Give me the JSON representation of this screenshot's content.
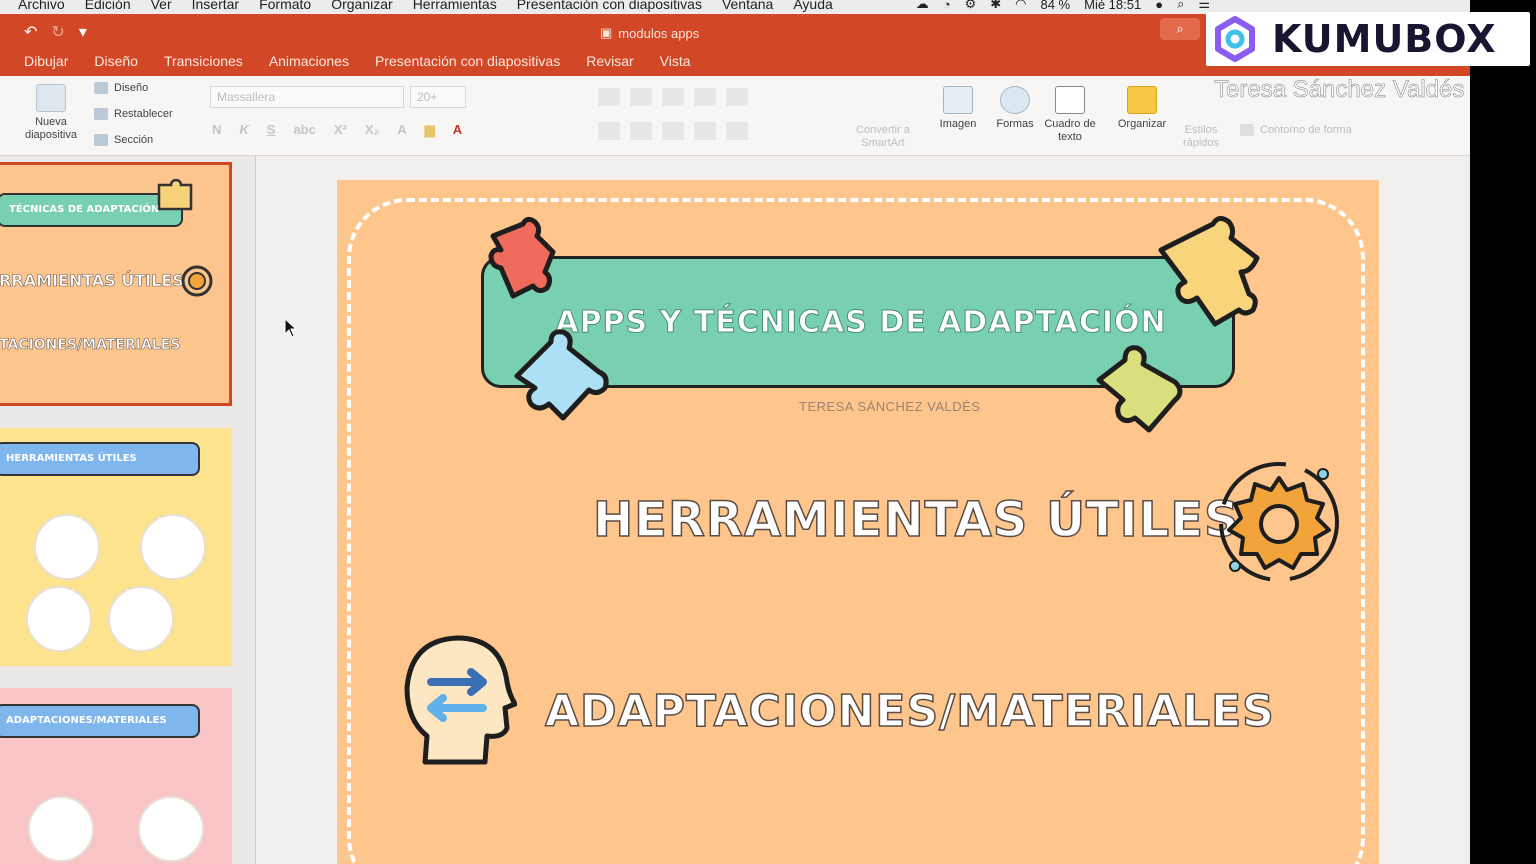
{
  "menubar": {
    "items": [
      "Archivo",
      "Edición",
      "Ver",
      "Insertar",
      "Formato",
      "Organizar",
      "Herramientas",
      "Presentación con diapositivas",
      "Ventana",
      "Ayuda"
    ],
    "battery": "84 %",
    "clock": "Mié 18:51"
  },
  "titlebar": {
    "document": "modulos apps"
  },
  "tabs": [
    "Dibujar",
    "Diseño",
    "Transiciones",
    "Animaciones",
    "Presentación con diapositivas",
    "Revisar",
    "Vista"
  ],
  "ribbon": {
    "new_slide": "Nueva diapositiva",
    "layout": "Diseño",
    "reset": "Restablecer",
    "section": "Sección",
    "font": "Massallera",
    "size": "20+",
    "convert_smartart": "Convertir a SmartArt",
    "image": "Imagen",
    "shapes": "Formas",
    "textbox": "Cuadro de texto",
    "arrange": "Organizar",
    "quick_styles": "Estilos rápidos",
    "shape_outline": "Contorno de forma"
  },
  "thumbnails": {
    "t1": {
      "pill": "TÉCNICAS DE ADAPTACIÓN",
      "line1": "RRAMIENTAS ÚTILES",
      "line2": "TACIONES/MATERIALES"
    },
    "t2": {
      "pill": "HERRAMIENTAS ÚTILES",
      "c1": "",
      "c2": "",
      "c3": "",
      "c4": ""
    },
    "t3": {
      "pill": "ADAPTACIONES/MATERIALES",
      "c1": "",
      "c2": ""
    }
  },
  "slide": {
    "title": "APPS Y TÉCNICAS DE ADAPTACIÓN",
    "author": "TERESA SÁNCHEZ VALDÉS",
    "line1": "HERRAMIENTAS ÚTILES",
    "line2": "ADAPTACIONES/MATERIALES"
  },
  "watermark": {
    "brand": "KUMUBOX",
    "name": "Teresa Sánchez Valdés"
  },
  "colors": {
    "ribbon": "#d24726",
    "slide_bg": "#fec58c",
    "banner": "#79d0b0"
  }
}
